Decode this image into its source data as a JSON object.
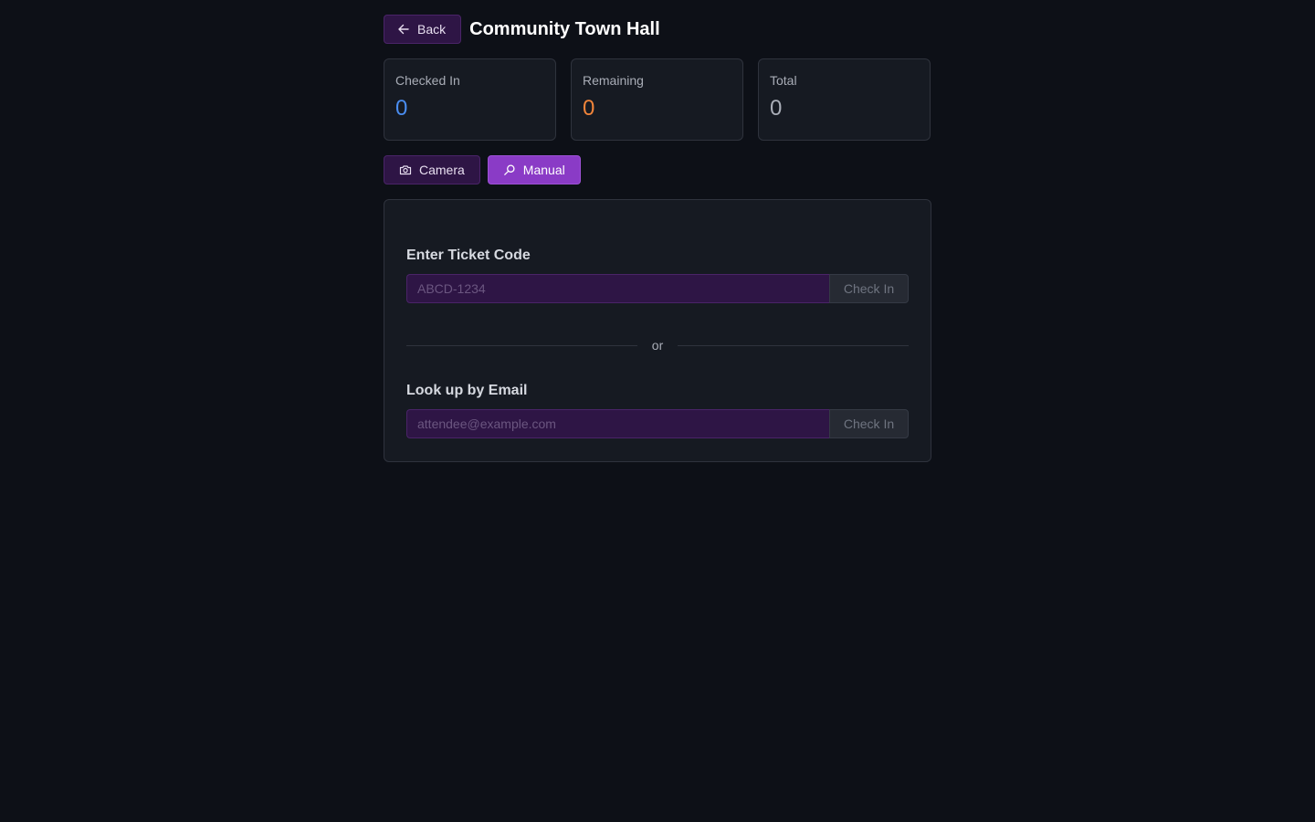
{
  "header": {
    "back_label": "Back",
    "title": "Community Town Hall"
  },
  "stats": [
    {
      "label": "Checked In",
      "value": "0",
      "color": "#4a8df0"
    },
    {
      "label": "Remaining",
      "value": "0",
      "color": "#f0843a"
    },
    {
      "label": "Total",
      "value": "0",
      "color": "#a9adb7"
    }
  ],
  "modes": {
    "camera_label": "Camera",
    "manual_label": "Manual",
    "active": "Manual"
  },
  "manual": {
    "ticket": {
      "label": "Enter Ticket Code",
      "placeholder": "ABCD-1234",
      "value": "",
      "button_label": "Check In"
    },
    "divider_text": "or",
    "email": {
      "label": "Look up by Email",
      "placeholder": "attendee@example.com",
      "value": "",
      "button_label": "Check In"
    }
  },
  "icons": {
    "back": "arrow-left-icon",
    "camera": "camera-icon",
    "manual": "search-icon"
  }
}
